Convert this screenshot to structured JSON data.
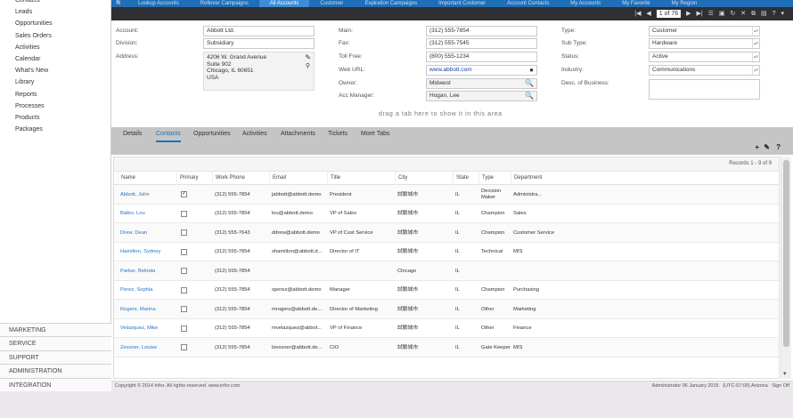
{
  "sidebar": {
    "items": [
      "Contacts",
      "Leads",
      "Opportunities",
      "Sales Orders",
      "Activities",
      "Calendar",
      "What's New",
      "Library",
      "Reports",
      "Processes",
      "Products",
      "Packages"
    ],
    "sections": [
      "MARKETING",
      "SERVICE",
      "SUPPORT",
      "ADMINISTRATION",
      "INTEGRATION"
    ]
  },
  "topnav": {
    "tabs": [
      "Lookup Accounts",
      "Rollover Campaigns",
      "All Accounts",
      "Customer",
      "Expiration Campaigns",
      "Important Customer",
      "Account Contacts",
      "My Accounts",
      "My Favorite",
      "My Region"
    ],
    "active": 2
  },
  "recordbar": {
    "position": "1 of 76",
    "icons": [
      "first-icon",
      "prev-icon",
      "next-icon",
      "last-icon",
      "list-icon",
      "save-icon",
      "refresh-icon",
      "delete-icon",
      "copy-icon",
      "print-icon",
      "help-icon",
      "menu-down-icon"
    ]
  },
  "form": {
    "account_label": "Account:",
    "account": "Abbott Ltd.",
    "division_label": "Division:",
    "division": "Subsidiary",
    "address_label": "Address:",
    "address_lines": [
      "4206 W. Grand Avenue",
      "Suite 902",
      "Chicago, IL 60651",
      "USA"
    ],
    "main_label": "Main:",
    "main": "(312) 555-7854",
    "fax_label": "Fax:",
    "fax": "(312) 555-7545",
    "tollfree_label": "Toll Free:",
    "tollfree": "(800) 555-1234",
    "web_label": "Web URL:",
    "web": "www.abbott.com",
    "owner_label": "Owner:",
    "owner": "Midwest",
    "accmgr_label": "Acc Manager:",
    "accmgr": "Hogan, Lee",
    "type_label": "Type:",
    "type": "Customer",
    "subtype_label": "Sub Type:",
    "subtype": "Hardware",
    "status_label": "Status:",
    "status": "Active",
    "industry_label": "Industry:",
    "industry": "Communications",
    "desc_label": "Desc. of Business:"
  },
  "drop_hint": "drag a tab here to show it in this area",
  "tabs": [
    "Details",
    "Contacts",
    "Opportunities",
    "Activities",
    "Attachments",
    "Tickets",
    "More Tabs"
  ],
  "active_tab": 1,
  "grid": {
    "count": "Records 1 - 9 of 9",
    "columns": [
      "Name",
      "Primary",
      "Work Phone",
      "Email",
      "Title",
      "City",
      "State",
      "Type",
      "Department"
    ],
    "rows": [
      {
        "name": "Abbott, John",
        "primary": true,
        "phone": "(312) 555-7854",
        "email": "jabbott@abbott.demo",
        "title": "President",
        "city": "試驗城市",
        "state": "IL",
        "type": "Decision Maker",
        "dept": "Administra..."
      },
      {
        "name": "Balbo, Lou",
        "primary": false,
        "phone": "(312) 555-7854",
        "email": "lou@abbott.demo",
        "title": "VP of Sales",
        "city": "試驗城市",
        "state": "IL",
        "type": "Champion",
        "dept": "Sales"
      },
      {
        "name": "Drew, Dean",
        "primary": false,
        "phone": "(312) 555-7643",
        "email": "ddrew@abbott.demo",
        "title": "VP of Cust Service",
        "city": "試驗城市",
        "state": "IL",
        "type": "Champion",
        "dept": "Customer Service"
      },
      {
        "name": "Hamilton, Sydney",
        "primary": false,
        "phone": "(312) 555-7854",
        "email": "shamilton@abbott.d...",
        "title": "Director of IT",
        "city": "試驗城市",
        "state": "IL",
        "type": "Technical",
        "dept": "MIS"
      },
      {
        "name": "Parker, Belinda",
        "primary": false,
        "phone": "(312) 555-7854",
        "email": "",
        "title": "",
        "city": "Chicago",
        "state": "IL",
        "type": "",
        "dept": ""
      },
      {
        "name": "Perez, Sophia",
        "primary": false,
        "phone": "(312) 555-7854",
        "email": "sperez@abbott.demo",
        "title": "Manager",
        "city": "試驗城市",
        "state": "IL",
        "type": "Champion",
        "dept": "Purchasing"
      },
      {
        "name": "Rogers, Marina",
        "primary": false,
        "phone": "(312) 555-7854",
        "email": "mrogers@abbott.de...",
        "title": "Director of Marketing",
        "city": "試驗城市",
        "state": "IL",
        "type": "Other",
        "dept": "Marketing"
      },
      {
        "name": "Velazquez, Mike",
        "primary": false,
        "phone": "(312) 555-7854",
        "email": "mvelazquez@abbot...",
        "title": "VP of Finance",
        "city": "試驗城市",
        "state": "IL",
        "type": "Other",
        "dept": "Finance"
      },
      {
        "name": "Zessner, Louise",
        "primary": false,
        "phone": "(312) 555-7854",
        "email": "lzessner@abbott.de...",
        "title": "CIO",
        "city": "試驗城市",
        "state": "IL",
        "type": "Gate Keeper",
        "dept": "MIS"
      }
    ]
  },
  "footer": {
    "copyright": "Copyright © 2014 Infor. All rights reserved. www.infor.com",
    "user": "Administrator",
    "date": "06 January 2015",
    "tz": "(UTC-07:00) Arizona",
    "signoff": "Sign Off"
  }
}
